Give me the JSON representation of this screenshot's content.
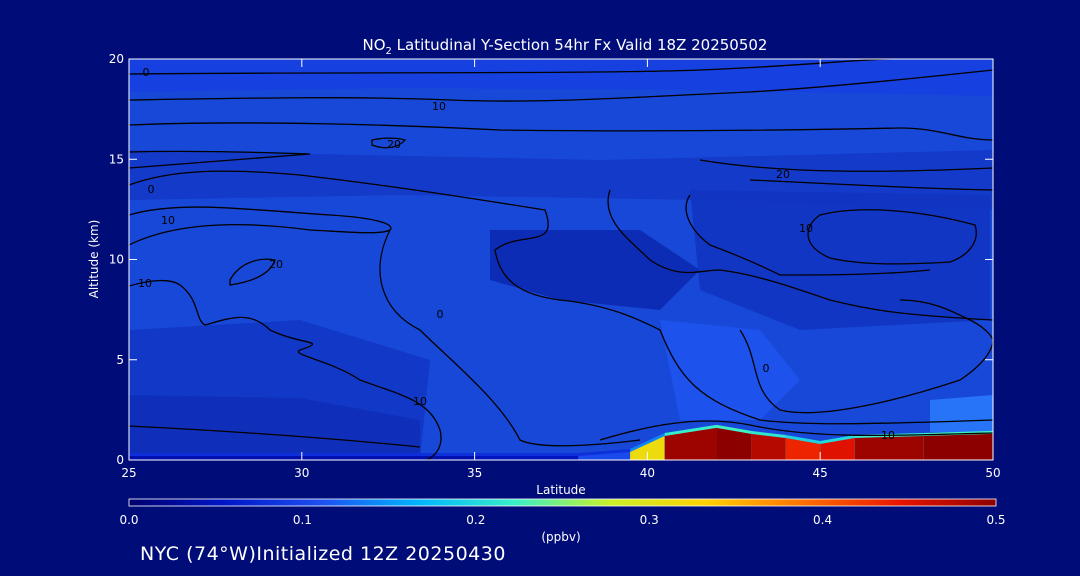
{
  "chart_data": {
    "type": "heatmap",
    "title_prefix": "NO",
    "title_subscript": "2",
    "title_suffix": " Latitudinal Y-Section 54hr  Fx Valid 18Z 20250502",
    "xlabel": "Latitude",
    "ylabel": "Altitude (km)",
    "xlim": [
      25,
      50
    ],
    "ylim": [
      0,
      20
    ],
    "xticks": [
      "25",
      "30",
      "35",
      "40",
      "45",
      "50"
    ],
    "yticks": [
      "0",
      "5",
      "10",
      "15",
      "20"
    ],
    "colorbar": {
      "label": "(ppbv)",
      "range": [
        0.0,
        0.5
      ],
      "ticks": [
        "0.0",
        "0.1",
        "0.2",
        "0.3",
        "0.4",
        "0.5"
      ],
      "colors": [
        "#00006e",
        "#0016c8",
        "#1e50f0",
        "#00b4ff",
        "#38f0c8",
        "#c8f028",
        "#ffd000",
        "#ff7000",
        "#e81400",
        "#8c0000"
      ]
    },
    "surface_layer": [
      {
        "lat": 25.0,
        "top_km": 0.2,
        "value": 0.04
      },
      {
        "lat": 30.0,
        "top_km": 0.2,
        "value": 0.04
      },
      {
        "lat": 35.0,
        "top_km": 0.2,
        "value": 0.04
      },
      {
        "lat": 38.0,
        "top_km": 0.2,
        "value": 0.06
      },
      {
        "lat": 39.5,
        "top_km": 0.4,
        "value": 0.15
      },
      {
        "lat": 40.5,
        "top_km": 1.2,
        "value": 0.48
      },
      {
        "lat": 42.0,
        "top_km": 1.6,
        "value": 0.5
      },
      {
        "lat": 43.0,
        "top_km": 1.3,
        "value": 0.5
      },
      {
        "lat": 44.0,
        "top_km": 1.1,
        "value": 0.45
      },
      {
        "lat": 45.0,
        "top_km": 0.8,
        "value": 0.42
      },
      {
        "lat": 46.0,
        "top_km": 1.1,
        "value": 0.48
      },
      {
        "lat": 48.0,
        "top_km": 1.2,
        "value": 0.5
      },
      {
        "lat": 50.0,
        "top_km": 1.3,
        "value": 0.5
      }
    ],
    "contour_labels": [
      "0",
      "10",
      "20",
      "0",
      "10",
      "10",
      "20",
      "0",
      "10",
      "20",
      "10",
      "0",
      "10"
    ]
  },
  "footer": {
    "location": "NYC (74°W)",
    "initialized": "Initialized 12Z 20250430"
  }
}
